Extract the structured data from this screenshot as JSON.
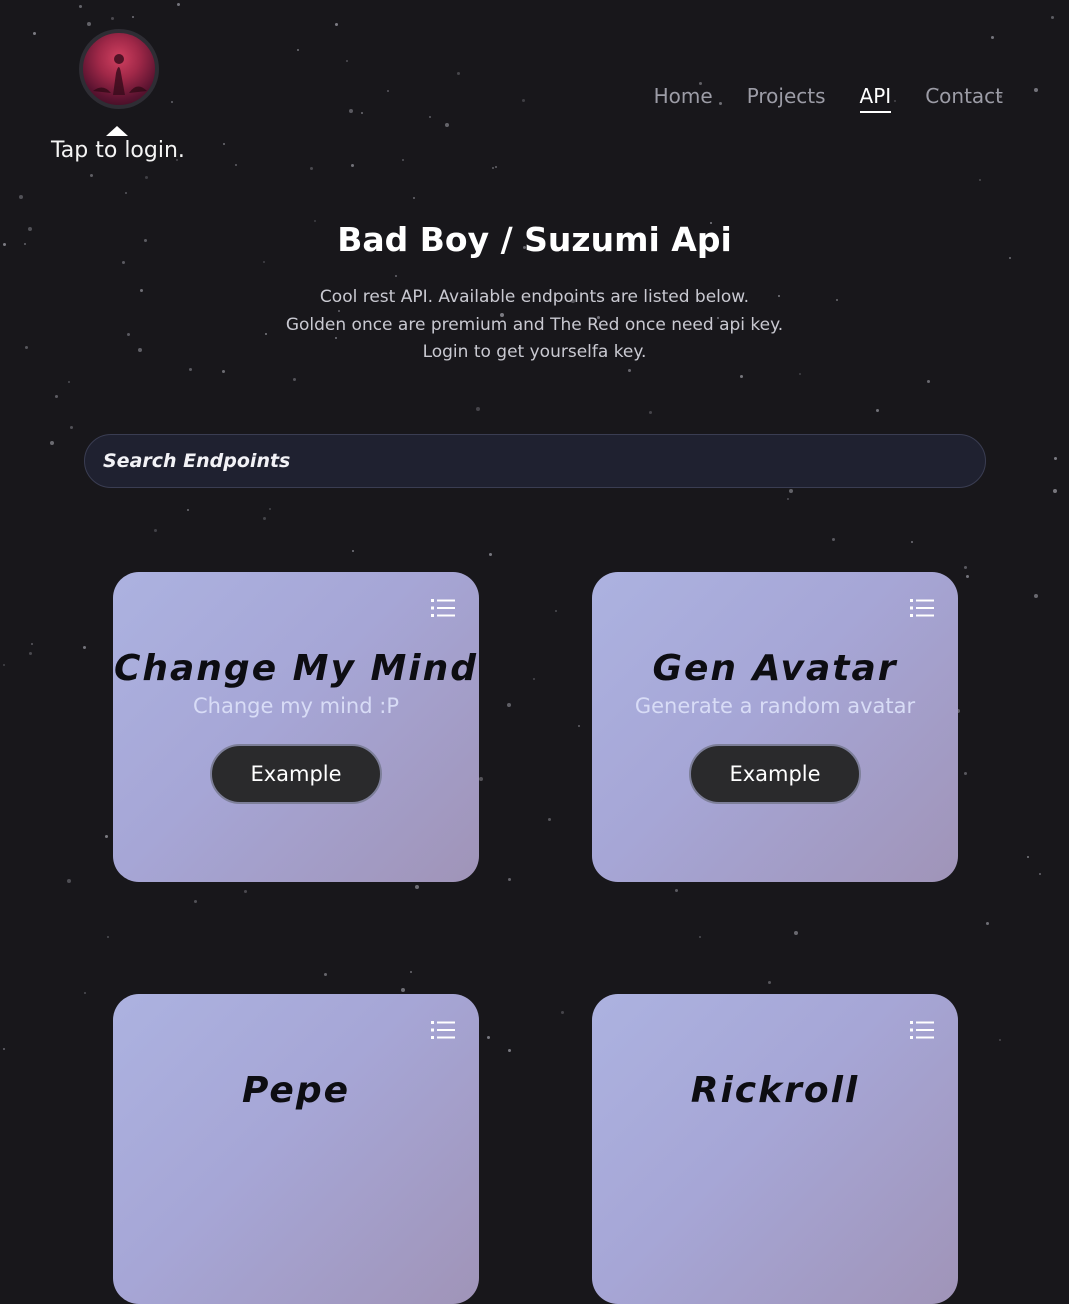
{
  "header": {
    "login_text": "Tap to login.",
    "avatar_icon": "avatar-image"
  },
  "nav": {
    "items": [
      {
        "label": "Home",
        "active": false
      },
      {
        "label": "Projects",
        "active": false
      },
      {
        "label": "API",
        "active": true
      },
      {
        "label": "Contact",
        "active": false
      }
    ]
  },
  "hero": {
    "title": "Bad Boy / Suzumi Api",
    "description": [
      "Cool rest API. Available endpoints are listed below.",
      "Golden once are premium and The Red once need api key.",
      "Login to get yourselfa key."
    ]
  },
  "search": {
    "placeholder": "Search Endpoints",
    "value": ""
  },
  "cards": [
    {
      "title": "Change My Mind",
      "subtitle": "Change my mind :P",
      "button": "Example",
      "icon": "list-icon"
    },
    {
      "title": "Gen Avatar",
      "subtitle": "Generate a random avatar",
      "button": "Example",
      "icon": "list-icon"
    },
    {
      "title": "Pepe",
      "subtitle": "",
      "button": "",
      "icon": "list-icon"
    },
    {
      "title": "Rickroll",
      "subtitle": "",
      "button": "",
      "icon": "list-icon"
    }
  ],
  "colors": {
    "background": "#18171b",
    "card_gradient_start": "#acb2e0",
    "card_gradient_end": "#a094b8",
    "button_bg": "#2a2a2c",
    "search_bg": "#1f2130"
  }
}
